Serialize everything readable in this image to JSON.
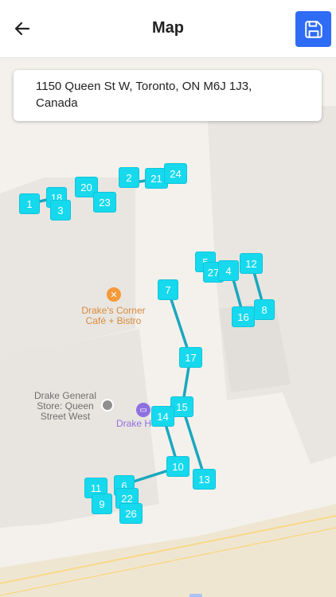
{
  "header": {
    "title": "Map",
    "back_icon": "arrow-left-icon",
    "save_icon": "floppy-disk-icon"
  },
  "address": {
    "line1": "1150 Queen St W, Toronto, ON M6J 1J3,",
    "line2": "Canada"
  },
  "colors": {
    "accent": "#2f6cf5",
    "marker": "#17d9ee",
    "route": "#1aa7bf"
  },
  "map_labels": {
    "drakes_corner_line1": "Drake's Corner",
    "drakes_corner_line2": "Café + Bistro",
    "drake_general_line1": "Drake General",
    "drake_general_line2": "Store: Queen",
    "drake_general_line3": "Street West",
    "drake_hotel": "Drake H"
  },
  "markers": [
    "1",
    "18",
    "3",
    "20",
    "23",
    "2",
    "21",
    "24",
    "5",
    "27",
    "4",
    "12",
    "8",
    "16",
    "7",
    "17",
    "15",
    "14",
    "10",
    "13",
    "11",
    "6",
    "22",
    "9",
    "26"
  ]
}
